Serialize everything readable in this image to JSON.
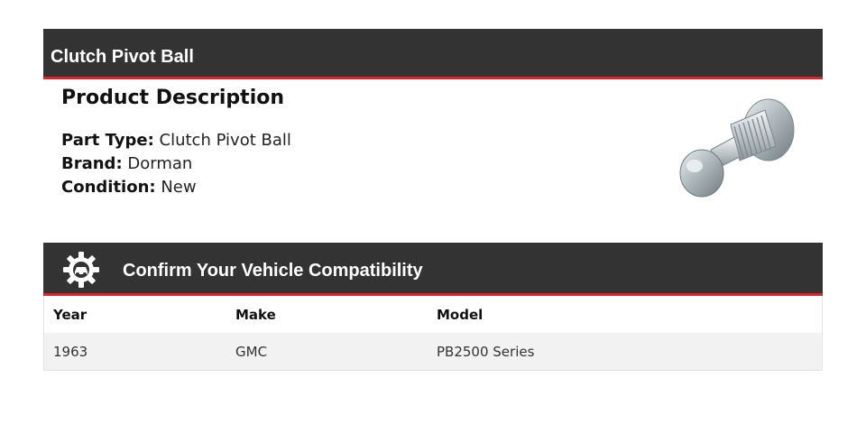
{
  "header": {
    "title": "Clutch Pivot Ball"
  },
  "description": {
    "heading": "Product Description",
    "specs": [
      {
        "label": "Part Type:",
        "value": "Clutch Pivot Ball"
      },
      {
        "label": "Brand:",
        "value": "Dorman"
      },
      {
        "label": "Condition:",
        "value": "New"
      }
    ]
  },
  "compatibility": {
    "title": "Confirm Your Vehicle Compatibility",
    "icon": "gear-car-icon",
    "columns": [
      "Year",
      "Make",
      "Model"
    ],
    "rows": [
      {
        "year": "1963",
        "make": "GMC",
        "model": "PB2500 Series"
      }
    ]
  },
  "colors": {
    "bar": "#333333",
    "accent": "#d9262c",
    "row_alt": "#f2f2f2"
  }
}
